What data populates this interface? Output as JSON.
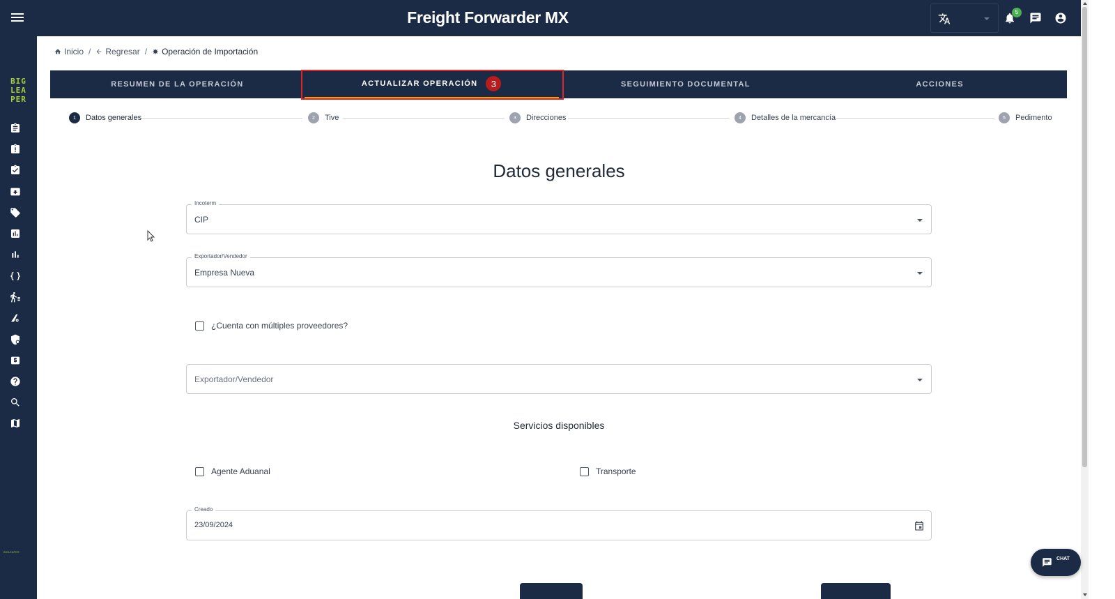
{
  "header": {
    "title": "Freight Forwarder MX",
    "notification_count": "5"
  },
  "sidebar": {
    "logo_lines": [
      "BIG",
      "LEA",
      "PER"
    ],
    "footer_logo": "BIGLEAPER",
    "icons": [
      "clipboard-icon",
      "clipboard-alert-icon",
      "clipboard-check-icon",
      "archive-icon",
      "tag-icon",
      "report-chart-icon",
      "bar-chart-icon",
      "code-braces-icon",
      "human-walk-icon",
      "road-icon",
      "shield-icon",
      "cash-icon",
      "help-icon",
      "search-icon",
      "map-icon"
    ]
  },
  "breadcrumb": {
    "home": "Inicio",
    "back": "Regresar",
    "current": "Operación de Importación"
  },
  "tabs": [
    {
      "label": "RESUMEN DE LA OPERACIÓN"
    },
    {
      "label": "ACTUALIZAR OPERACIÓN",
      "badge": "3"
    },
    {
      "label": "SEGUIMIENTO DOCUMENTAL"
    },
    {
      "label": "ACCIONES"
    }
  ],
  "stepper": [
    {
      "num": "1",
      "label": "Datos generales"
    },
    {
      "num": "2",
      "label": "Tive"
    },
    {
      "num": "3",
      "label": "Direcciones"
    },
    {
      "num": "4",
      "label": "Detalles de la mercancía"
    },
    {
      "num": "5",
      "label": "Pedimento"
    }
  ],
  "form": {
    "title": "Datos generales",
    "incoterm": {
      "label": "Incoterm",
      "value": "CIP"
    },
    "exporter": {
      "label": "Exportador/Vendedor",
      "value": "Empresa Nueva"
    },
    "multi_suppliers_label": "¿Cuenta con múltiples proveedores?",
    "exporter2": {
      "placeholder": "Exportador/Vendedor"
    },
    "services_title": "Servicios disponibles",
    "service_customs": "Agente Aduanal",
    "service_transport": "Transporte",
    "created": {
      "label": "Creado",
      "value": "23/09/2024"
    }
  },
  "chat": {
    "label": "CHAT"
  },
  "colors": {
    "primary": "#1c2b45",
    "badge_red": "#b91c1c",
    "notif_green": "#4caf50",
    "logo_green": "#a5d037"
  }
}
